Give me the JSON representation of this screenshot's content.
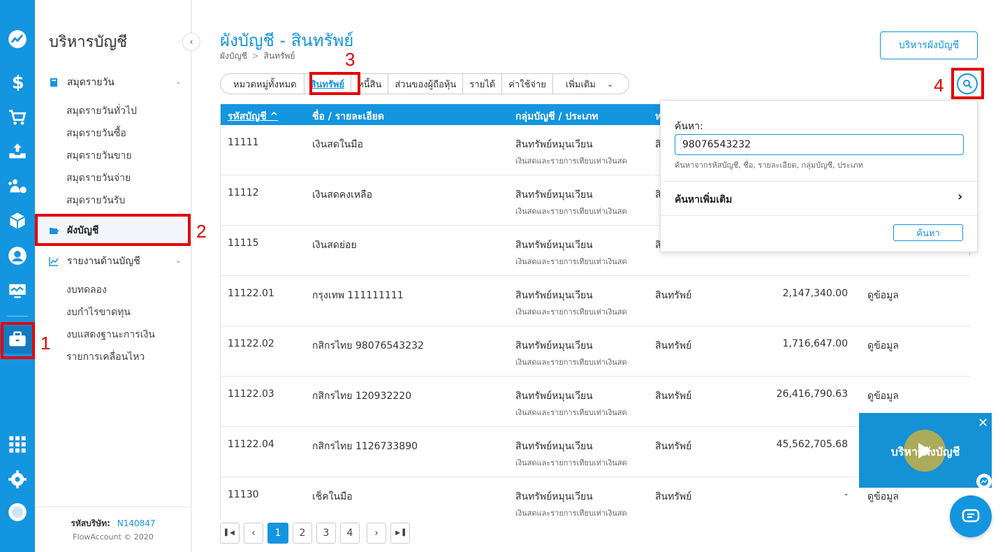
{
  "sidebar": {
    "title": "บริหารบัญชี",
    "groups": [
      {
        "label": "สมุดรายวัน",
        "items": [
          "สมุดรายวันทั่วไป",
          "สมุดรายวันซื้อ",
          "สมุดรายวันขาย",
          "สมุดรายวันจ่าย",
          "สมุดรายวันรับ"
        ]
      },
      {
        "label": "ผังบัญชี",
        "items": []
      },
      {
        "label": "รายงานด้านบัญชี",
        "items": [
          "งบทดลอง",
          "งบกำไรขาดทุน",
          "งบแสดงฐานะการเงิน",
          "รายการเคลื่อนไหว"
        ]
      }
    ],
    "company_label": "รหัสบริษัท:",
    "company_code": "N140847",
    "copyright": "FlowAccount © 2020"
  },
  "rail_icons": [
    "dashboard-icon",
    "dollar-icon",
    "cart-icon",
    "inbox-upload-icon",
    "people-money-icon",
    "box-icon",
    "user-circle-icon",
    "monitor-chart-icon",
    "briefcase-icon",
    "apps-grid-icon",
    "settings-icon",
    "profile-icon"
  ],
  "header": {
    "title": "ผังบัญชี - สินทรัพย์",
    "breadcrumb_root": "ผังบัญชี",
    "breadcrumb_sep": ">",
    "breadcrumb_current": "สินทรัพย์",
    "manage_button": "บริหารผังบัญชี"
  },
  "tabs": [
    {
      "label": "หมวดหมู่ทั้งหมด",
      "selected": false
    },
    {
      "label": "สินทรัพย์",
      "selected": true
    },
    {
      "label": "หนี้สิน",
      "selected": false
    },
    {
      "label": "ส่วนของผู้ถือหุ้น",
      "selected": false
    },
    {
      "label": "รายได้",
      "selected": false
    },
    {
      "label": "ค่าใช้จ่าย",
      "selected": false
    },
    {
      "label": "เพิ่มเติม",
      "selected": false
    }
  ],
  "table": {
    "columns": [
      "รหัสบัญชี ^",
      "ชื่อ / รายละเอียด",
      "กลุ่มบัญชี / ประเภท",
      "ห"
    ],
    "rows": [
      {
        "code": "11111",
        "name": "เงินสดในมือ",
        "group": "สินทรัพย์หมุนเวียน",
        "group_sub": "เงินสดและรายการเทียบเท่าเงินสด",
        "type": "สิ",
        "balance": "",
        "action": ""
      },
      {
        "code": "11112",
        "name": "เงินสดคงเหลือ",
        "group": "สินทรัพย์หมุนเวียน",
        "group_sub": "เงินสดและรายการเทียบเท่าเงินสด",
        "type": "สิ",
        "balance": "",
        "action": ""
      },
      {
        "code": "11115",
        "name": "เงินสดย่อย",
        "group": "สินทรัพย์หมุนเวียน",
        "group_sub": "เงินสดและรายการเทียบเท่าเงินสด",
        "type": "สิ",
        "balance": "",
        "action": ""
      },
      {
        "code": "11122.01",
        "name": "กรุงเทพ 111111111",
        "group": "สินทรัพย์หมุนเวียน",
        "group_sub": "เงินสดและรายการเทียบเท่าเงินสด",
        "type": "สินทรัพย์",
        "balance": "2,147,340.00",
        "action": "ดูข้อมูล"
      },
      {
        "code": "11122.02",
        "name": "กสิกรไทย 98076543232",
        "group": "สินทรัพย์หมุนเวียน",
        "group_sub": "เงินสดและรายการเทียบเท่าเงินสด",
        "type": "สินทรัพย์",
        "balance": "1,716,647.00",
        "action": "ดูข้อมูล"
      },
      {
        "code": "11122.03",
        "name": "กสิกรไทย 120932220",
        "group": "สินทรัพย์หมุนเวียน",
        "group_sub": "เงินสดและรายการเทียบเท่าเงินสด",
        "type": "สินทรัพย์",
        "balance": "26,416,790.63",
        "action": "ดูข้อมูล"
      },
      {
        "code": "11122.04",
        "name": "กสิกรไทย 1126733890",
        "group": "สินทรัพย์หมุนเวียน",
        "group_sub": "เงินสดและรายการเทียบเท่าเงินสด",
        "type": "สินทรัพย์",
        "balance": "45,562,705.68",
        "action": ""
      },
      {
        "code": "11130",
        "name": "เช็คในมือ",
        "group": "สินทรัพย์หมุนเวียน",
        "group_sub": "เงินสดและรายการเทียบเท่าเงินสด",
        "type": "สินทรัพย์",
        "balance": "-",
        "action": "ดูข้อมูล"
      }
    ]
  },
  "pagination": {
    "first": "⏮",
    "prev": "‹",
    "pages": [
      "1",
      "2",
      "3",
      "4"
    ],
    "current": "1",
    "next": "›",
    "last": "⏭"
  },
  "search_popover": {
    "label": "ค้นหา:",
    "value": "98076543232",
    "hint": "ค้นหาจากรหัสบัญชี, ชื่อ, รายละเอียด, กลุ่มบัญชี, ประเภท",
    "more": "ค้นหาเพิ่มเติม",
    "button": "ค้นหา"
  },
  "annotations": [
    "1",
    "2",
    "3",
    "4"
  ],
  "video_widget": {
    "text": "บริหารผังบัญชี",
    "close": "✕"
  },
  "colors": {
    "primary": "#1495e0",
    "annotation": "#e60000"
  }
}
